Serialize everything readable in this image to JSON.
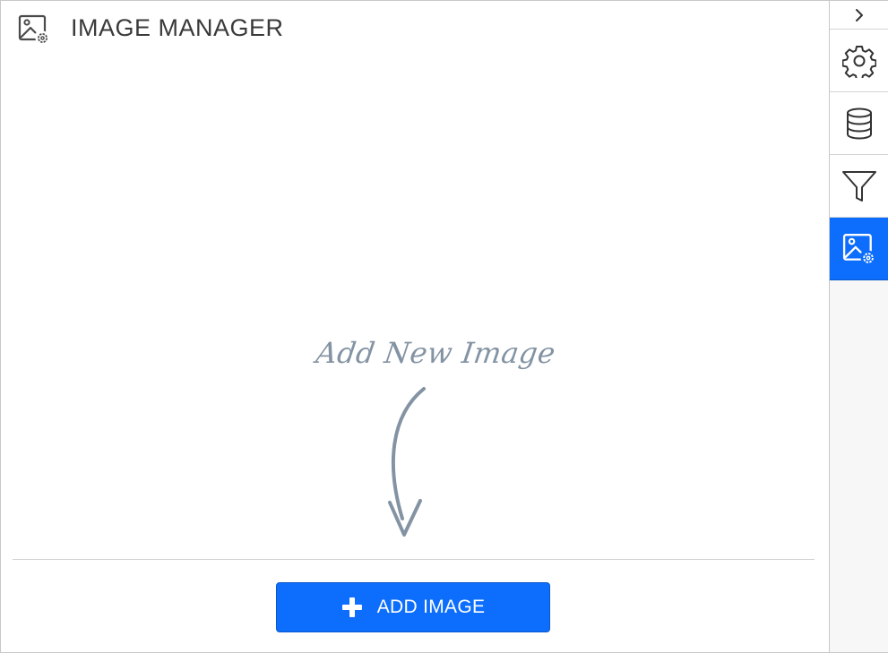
{
  "header": {
    "title": "IMAGE MANAGER",
    "icon": "image-settings-icon"
  },
  "hint": {
    "text": "Add New Image",
    "arrow_icon": "curved-arrow-down-icon"
  },
  "add_button": {
    "label": "ADD IMAGE",
    "icon": "plus-icon"
  },
  "sidebar": {
    "toggle_icon": "chevron-right-icon",
    "items": [
      {
        "name": "settings",
        "icon": "gear-icon",
        "active": false
      },
      {
        "name": "data",
        "icon": "database-icon",
        "active": false
      },
      {
        "name": "filter",
        "icon": "filter-icon",
        "active": false
      },
      {
        "name": "image-manager",
        "icon": "image-settings-icon",
        "active": true
      }
    ]
  },
  "colors": {
    "accent": "#0d6efd",
    "hint": "#8393a3",
    "title": "#3a3a3a",
    "border": "#c8c8c8"
  }
}
